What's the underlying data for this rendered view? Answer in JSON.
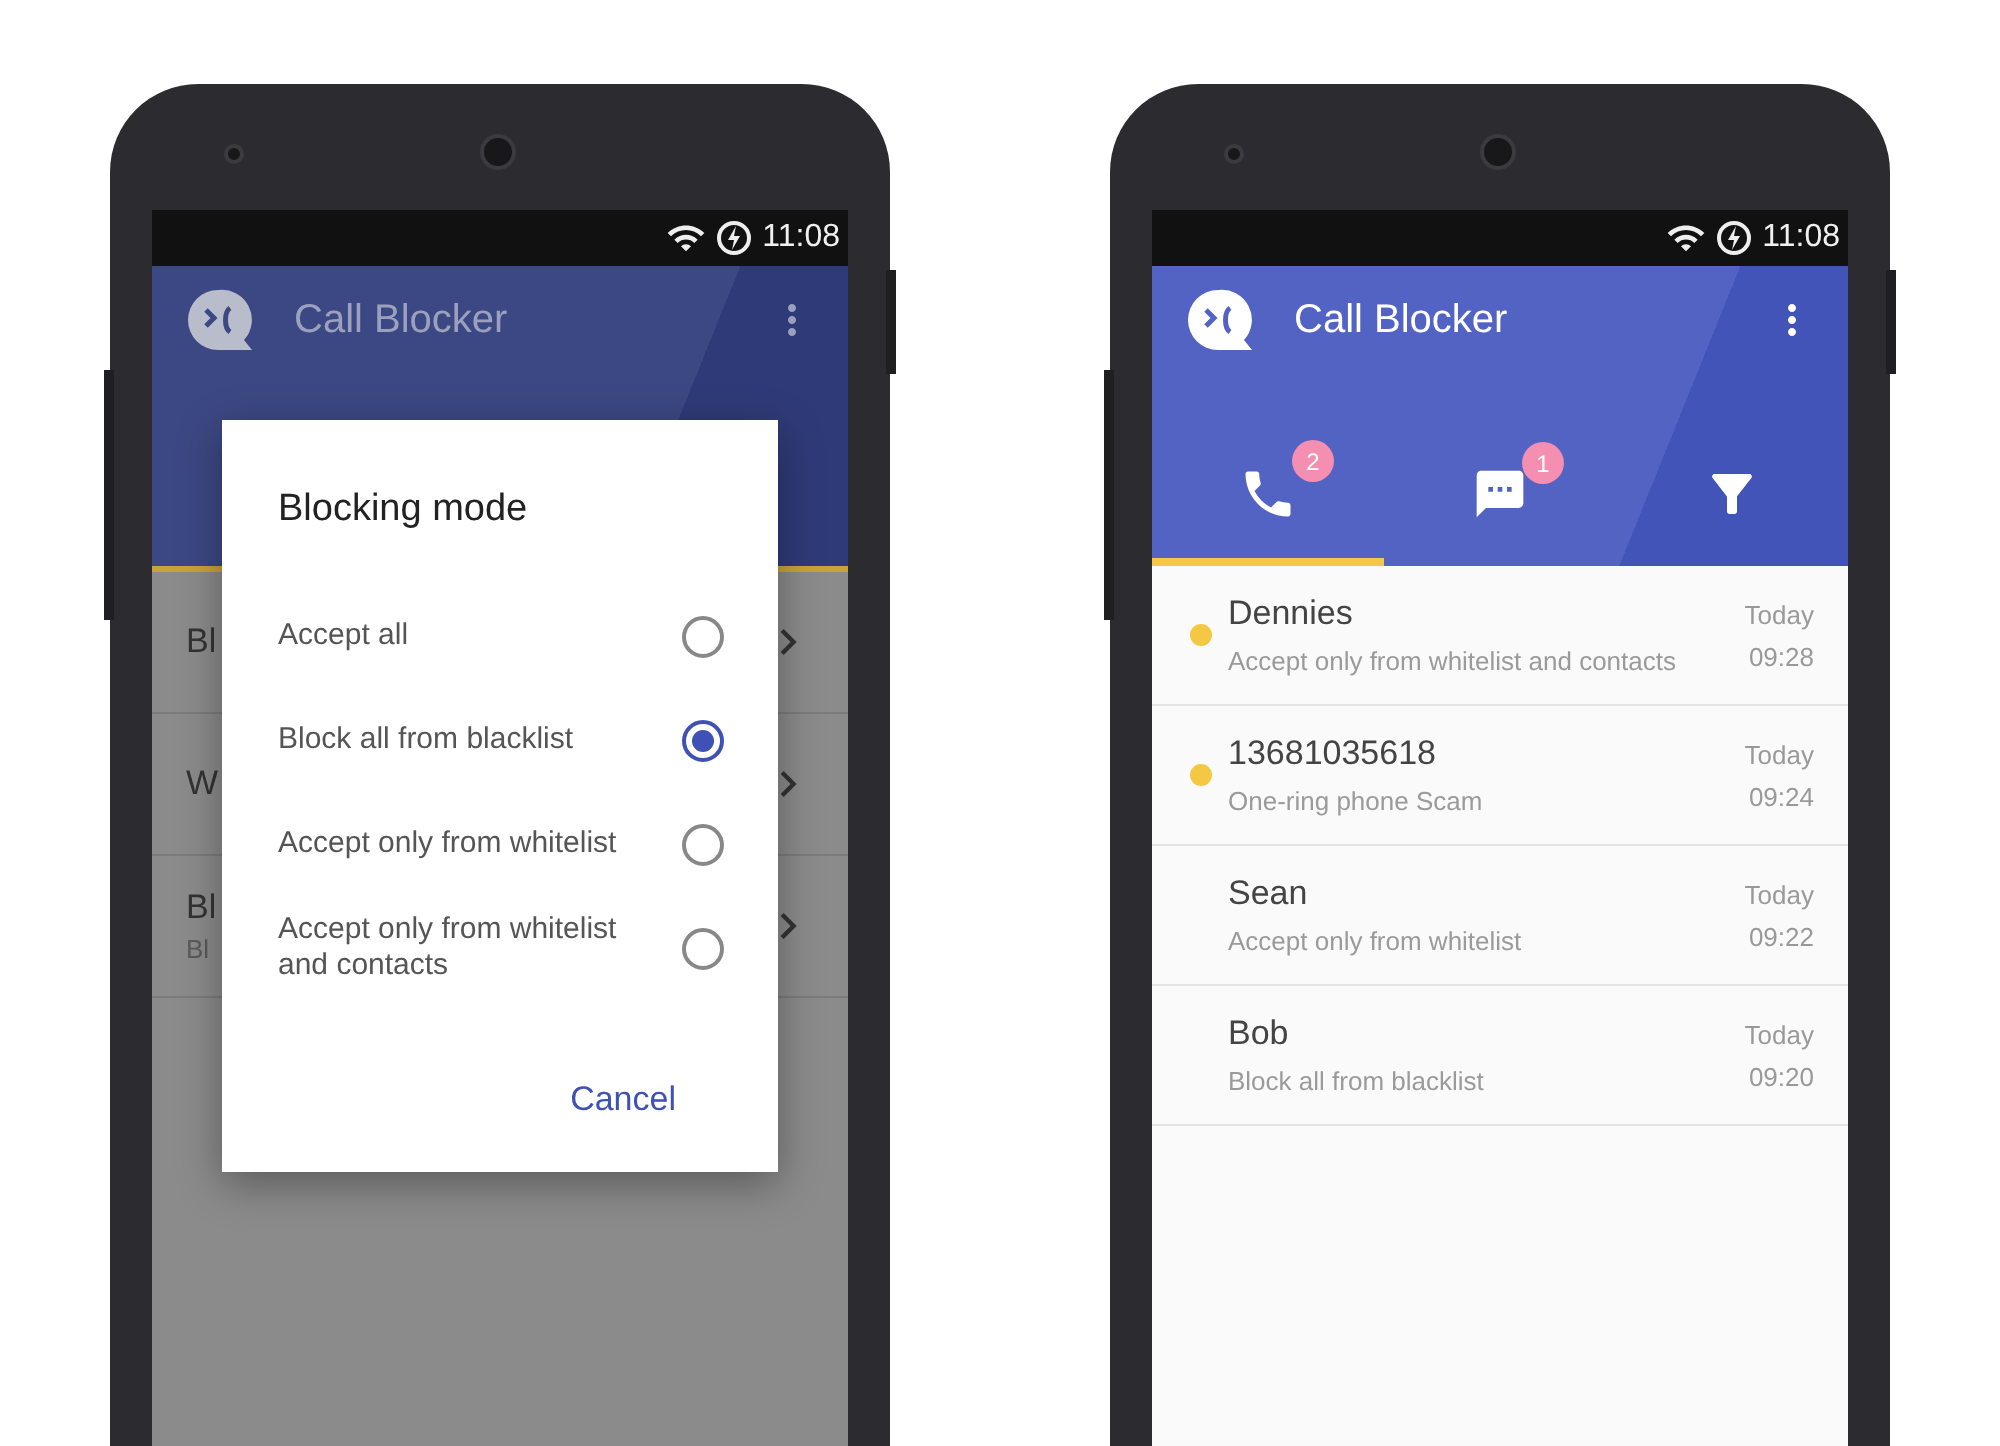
{
  "left_phone": {
    "status_time": "11:08",
    "app_title": "Call Blocker",
    "settings_rows": [
      {
        "title": "Bl"
      },
      {
        "title": "W"
      },
      {
        "title": "Bl",
        "subtitle": "Bl"
      }
    ],
    "dialog": {
      "title": "Blocking mode",
      "options": [
        {
          "label": "Accept all",
          "selected": false
        },
        {
          "label": "Block all from blacklist",
          "selected": true
        },
        {
          "label": "Accept only from whitelist",
          "selected": false
        },
        {
          "label": "Accept only from whitelist and contacts",
          "selected": false
        }
      ],
      "cancel": "Cancel"
    }
  },
  "right_phone": {
    "status_time": "11:08",
    "app_title": "Call Blocker",
    "tabs": [
      {
        "kind": "calls",
        "badge": "2",
        "selected": true
      },
      {
        "kind": "messages",
        "badge": "1",
        "selected": false
      },
      {
        "kind": "filter",
        "selected": false
      }
    ],
    "log": [
      {
        "name": "Dennies",
        "detail": "Accept only from whitelist and contacts",
        "day": "Today",
        "time": "09:28",
        "unread": true
      },
      {
        "name": "13681035618",
        "detail": "One-ring phone Scam",
        "day": "Today",
        "time": "09:24",
        "unread": true
      },
      {
        "name": "Sean",
        "detail": "Accept only from whitelist",
        "day": "Today",
        "time": "09:22",
        "unread": false
      },
      {
        "name": "Bob",
        "detail": "Block all from blacklist",
        "day": "Today",
        "time": "09:20",
        "unread": false
      }
    ]
  }
}
